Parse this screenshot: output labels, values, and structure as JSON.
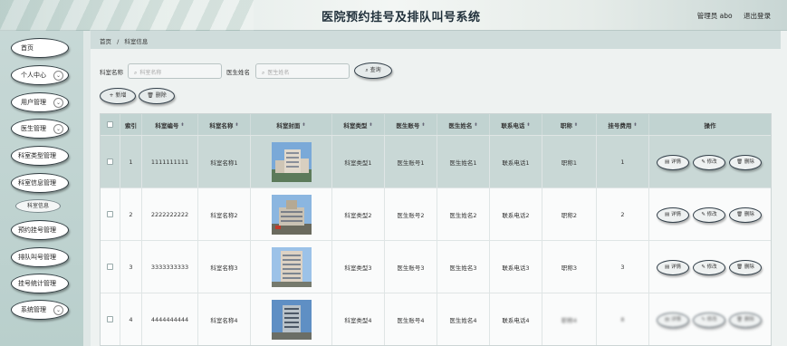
{
  "header": {
    "title": "医院预约挂号及排队叫号系统",
    "user": "管理员 abo",
    "logout": "退出登录"
  },
  "sidebar": {
    "items": [
      {
        "label": "首页",
        "has_chevron": false
      },
      {
        "label": "个人中心",
        "has_chevron": true
      },
      {
        "label": "用户管理",
        "has_chevron": true
      },
      {
        "label": "医生管理",
        "has_chevron": true
      },
      {
        "label": "科室类型管理",
        "has_chevron": false
      },
      {
        "label": "科室信息管理",
        "has_chevron": false
      },
      {
        "label": "预约挂号管理",
        "has_chevron": false
      },
      {
        "label": "排队叫号管理",
        "has_chevron": false
      },
      {
        "label": "挂号统计管理",
        "has_chevron": false
      },
      {
        "label": "系统管理",
        "has_chevron": true
      }
    ],
    "sub_item": "科室信息"
  },
  "breadcrumb": {
    "home": "首页",
    "sep": "/",
    "current": "科室信息"
  },
  "search": {
    "label1": "科室名称",
    "placeholder1": "科室名称",
    "label2": "医生姓名",
    "placeholder2": "医生姓名",
    "query_button": "查询"
  },
  "actions": {
    "add": "+ 新增",
    "delete": "删除"
  },
  "table": {
    "headers": [
      "索引",
      "科室编号",
      "科室名称",
      "科室封面",
      "科室类型",
      "医生账号",
      "医生姓名",
      "联系电话",
      "职称",
      "挂号费用",
      "操作"
    ],
    "rows": [
      {
        "index": "1",
        "code": "1111111111",
        "name": "科室名称1",
        "type": "科室类型1",
        "account": "医生账号1",
        "doctor": "医生姓名1",
        "phone": "联系电话1",
        "title": "职称1",
        "fee": "1"
      },
      {
        "index": "2",
        "code": "2222222222",
        "name": "科室名称2",
        "type": "科室类型2",
        "account": "医生账号2",
        "doctor": "医生姓名2",
        "phone": "联系电话2",
        "title": "职称2",
        "fee": "2"
      },
      {
        "index": "3",
        "code": "3333333333",
        "name": "科室名称3",
        "type": "科室类型3",
        "account": "医生账号3",
        "doctor": "医生姓名3",
        "phone": "联系电话3",
        "title": "职称3",
        "fee": "3"
      },
      {
        "index": "4",
        "code": "4444444444",
        "name": "科室名称4",
        "type": "科室类型4",
        "account": "医生账号4",
        "doctor": "医生姓名4",
        "phone": "联系电话4",
        "title": "职称4",
        "fee": "8"
      }
    ],
    "row_buttons": {
      "detail": "详情",
      "edit": "修改",
      "delete": "删除"
    }
  },
  "colors": {
    "accent": "#c9d8d6",
    "button_border": "#33404a"
  }
}
